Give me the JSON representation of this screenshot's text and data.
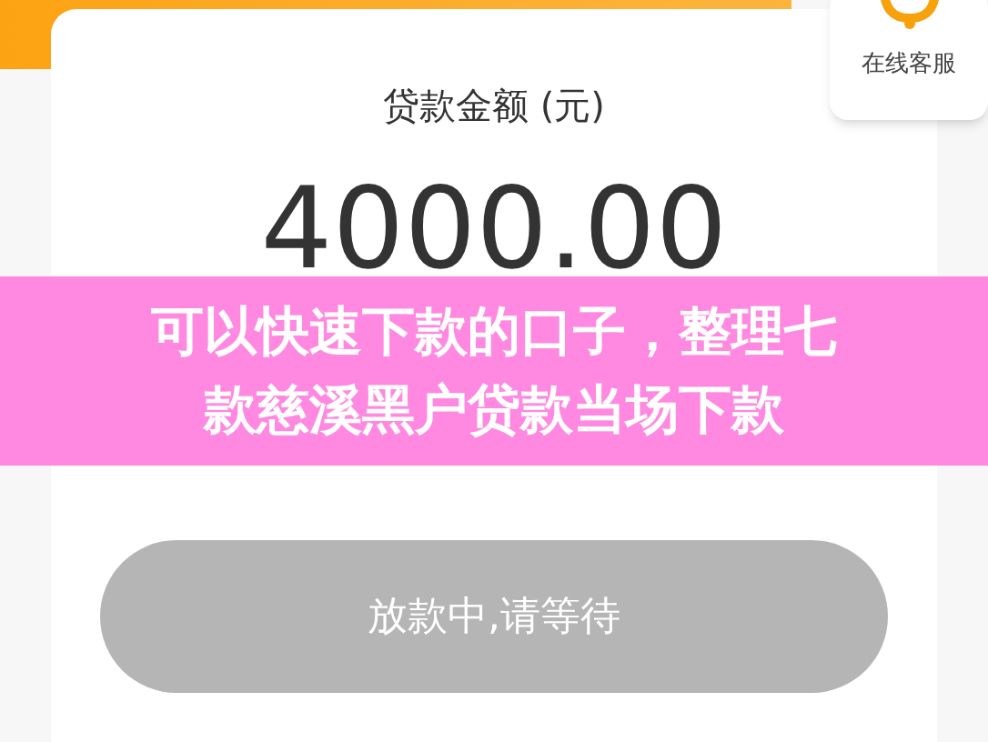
{
  "loan_card": {
    "label": "贷款金额 (元)",
    "amount": "4000.00"
  },
  "customer_service": {
    "label": "在线客服"
  },
  "banner": {
    "lines": [
      "可以快速下款的口子，整理七",
      "款慈溪黑户贷款当场下款"
    ]
  },
  "status_button": {
    "label": "放款中,请等待",
    "disabled": true
  }
}
